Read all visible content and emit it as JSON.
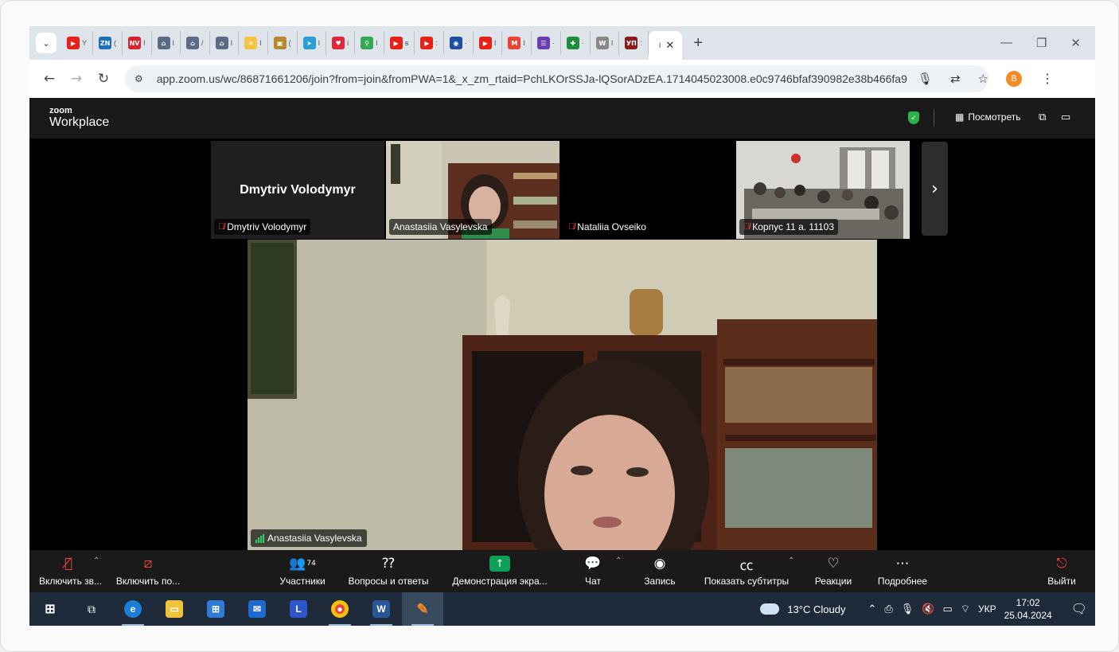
{
  "browser": {
    "tabs": [
      {
        "icon": "youtube-icon",
        "color": "#e62117",
        "text": "▶",
        "title": "Y"
      },
      {
        "icon": "zn-icon",
        "color": "#1f6fbf",
        "text": "ZN",
        "title": "("
      },
      {
        "icon": "nv-icon",
        "color": "#d8232a",
        "text": "NV",
        "title": "I"
      },
      {
        "icon": "gov-icon",
        "color": "#5b6b85",
        "text": "⌂",
        "title": "I"
      },
      {
        "icon": "gov-icon",
        "color": "#5b6b85",
        "text": "⌂",
        "title": "/"
      },
      {
        "icon": "gov-icon",
        "color": "#5b6b85",
        "text": "⌂",
        "title": "I"
      },
      {
        "icon": "sun-icon",
        "color": "#f4c542",
        "text": "☀",
        "title": "I"
      },
      {
        "icon": "bag-icon",
        "color": "#b58a2e",
        "text": "▣",
        "title": "("
      },
      {
        "icon": "telegram-icon",
        "color": "#2a9fd8",
        "text": "➤",
        "title": "I"
      },
      {
        "icon": "heart-icon",
        "color": "#e0283a",
        "text": "♥",
        "title": "i"
      },
      {
        "icon": "maps-icon",
        "color": "#34a853",
        "text": "⚲",
        "title": "I"
      },
      {
        "icon": "youtube-icon",
        "color": "#e62117",
        "text": "▶",
        "title": "ꞩ"
      },
      {
        "icon": "youtube-icon",
        "color": "#e62117",
        "text": "▶",
        "title": ":"
      },
      {
        "icon": "ua-icon",
        "color": "#1f4fa0",
        "text": "◉",
        "title": "·"
      },
      {
        "icon": "youtube-icon",
        "color": "#e62117",
        "text": "▶",
        "title": "I"
      },
      {
        "icon": "gmail-icon",
        "color": "#ea4335",
        "text": "M",
        "title": "I"
      },
      {
        "icon": "forms-icon",
        "color": "#6a3fb5",
        "text": "☰",
        "title": "·"
      },
      {
        "icon": "sheets-icon",
        "color": "#1e8e3e",
        "text": "✚",
        "title": "·"
      },
      {
        "icon": "wikipedia-icon",
        "color": "#888888",
        "text": "W",
        "title": "I"
      },
      {
        "icon": "up-icon",
        "color": "#8b1a1a",
        "text": "УП",
        "title": ":"
      }
    ],
    "active_tab": {
      "title": "I",
      "close": "✕"
    },
    "new_tab": "+",
    "url": "app.zoom.us/wc/86871661206/join?from=join&fromPWA=1&_x_zm_rtaid=PchLKOrSSJa-lQSorADzEA.1714045023008.e0c9746bfaf390982e38b466fa9...",
    "profile_initial": "B"
  },
  "zoom": {
    "logo_top": "zoom",
    "logo_bottom": "Workplace",
    "view_label": "Посмотреть",
    "participants": [
      {
        "name": "Dmytriv Volodymyr",
        "big_name": "Dmytriv Volodymyr",
        "muted": true,
        "video": false
      },
      {
        "name": "Anastasiia Vasylevska",
        "muted": false,
        "video": true,
        "active": true
      },
      {
        "name": "Nataliia Ovseiko",
        "muted": true,
        "video": false
      },
      {
        "name": "Корпус 11 а. 11103",
        "muted": true,
        "video": true
      }
    ],
    "main_speaker": "Anastasiia Vasylevska",
    "toolbar": {
      "unmute": "Включить зв...",
      "start_video": "Включить по...",
      "participants": "Участники",
      "participants_count": "74",
      "qa": "Вопросы и ответы",
      "share": "Демонстрация экра...",
      "chat": "Чат",
      "record": "Запись",
      "captions": "Показать субтитры",
      "reactions": "Реакции",
      "more": "Подробнее",
      "leave": "Выйти"
    }
  },
  "taskbar": {
    "weather": "13°C  Cloudy",
    "lang": "УКР",
    "time": "17:02",
    "date": "25.04.2024"
  },
  "colors": {
    "zoom_green": "#0e9f59",
    "muted_red": "#e8413f",
    "active_border": "#d6e38a",
    "leave_red": "#e8413f"
  }
}
